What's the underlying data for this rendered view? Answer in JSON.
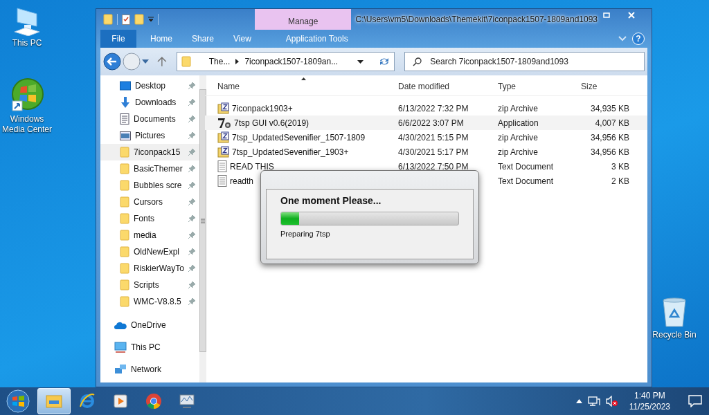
{
  "desktop": [
    {
      "label": "This PC",
      "kind": "pc"
    },
    {
      "label": "Windows Media Center",
      "kind": "wmc"
    },
    {
      "label": "Recycle Bin",
      "kind": "recycle"
    }
  ],
  "window": {
    "title": "C:\\Users\\vm5\\Downloads\\Themekit\\7iconpack1507-1809and1093",
    "context_tab": "Manage",
    "ribbon_tabs": [
      {
        "label": "File",
        "kind": "file"
      },
      {
        "label": "Home",
        "kind": "tab"
      },
      {
        "label": "Share",
        "kind": "tab"
      },
      {
        "label": "View",
        "kind": "tab"
      },
      {
        "label": "Application Tools",
        "kind": "tab"
      }
    ],
    "help": "?"
  },
  "address": {
    "breadcrumbs": [
      "The...",
      "7iconpack1507-1809an..."
    ]
  },
  "search": {
    "placeholder": "Search 7iconpack1507-1809and1093"
  },
  "nav": {
    "quick_access": [
      {
        "label": "Desktop",
        "kind": "desktop",
        "selected": false
      },
      {
        "label": "Downloads",
        "kind": "downloads",
        "selected": false
      },
      {
        "label": "Documents",
        "kind": "documents",
        "selected": false
      },
      {
        "label": "Pictures",
        "kind": "pictures",
        "selected": false
      },
      {
        "label": "7iconpack15",
        "kind": "folder",
        "selected": true
      },
      {
        "label": "BasicThemer",
        "kind": "folder",
        "selected": false
      },
      {
        "label": "Bubbles scre",
        "kind": "folder",
        "selected": false
      },
      {
        "label": "Cursors",
        "kind": "folder",
        "selected": false
      },
      {
        "label": "Fonts",
        "kind": "folder",
        "selected": false
      },
      {
        "label": "media",
        "kind": "folder",
        "selected": false
      },
      {
        "label": "OldNewExpl",
        "kind": "folder",
        "selected": false
      },
      {
        "label": "RiskierWayTo",
        "kind": "folder",
        "selected": false
      },
      {
        "label": "Scripts",
        "kind": "folder",
        "selected": false
      },
      {
        "label": "WMC-V8.8.5",
        "kind": "folder",
        "selected": false
      }
    ],
    "roots": [
      {
        "label": "OneDrive",
        "kind": "onedrive"
      },
      {
        "label": "This PC",
        "kind": "pc"
      },
      {
        "label": "Network",
        "kind": "network"
      }
    ]
  },
  "files": {
    "columns": [
      "Name",
      "Date modified",
      "Type",
      "Size"
    ],
    "rows": [
      {
        "name": "7iconpack1903+",
        "date": "6/13/2022 7:32 PM",
        "type": "zip Archive",
        "size": "34,935 KB",
        "kind": "zip",
        "selected": false
      },
      {
        "name": "7tsp GUI v0.6(2019)",
        "date": "6/6/2022 3:07 PM",
        "type": "Application",
        "size": "4,007 KB",
        "kind": "app",
        "selected": true
      },
      {
        "name": "7tsp_UpdatedSevenifier_1507-1809",
        "date": "4/30/2021 5:15 PM",
        "type": "zip Archive",
        "size": "34,956 KB",
        "kind": "zip",
        "selected": false
      },
      {
        "name": "7tsp_UpdatedSevenifier_1903+",
        "date": "4/30/2021 5:17 PM",
        "type": "zip Archive",
        "size": "34,956 KB",
        "kind": "zip",
        "selected": false
      },
      {
        "name": "READ THIS",
        "date": "6/13/2022 7:50 PM",
        "type": "Text Document",
        "size": "3 KB",
        "kind": "text",
        "selected": false
      },
      {
        "name": "readth",
        "type": "Text Document",
        "size": "2 KB",
        "kind": "text",
        "selected": false
      }
    ]
  },
  "dialog": {
    "heading": "One moment Please...",
    "level": 0.1,
    "status": "Preparing 7tsp"
  },
  "taskbar": {
    "apps": [
      {
        "kind": "explorer",
        "active": true
      },
      {
        "kind": "ie",
        "active": false
      },
      {
        "kind": "media",
        "active": false
      },
      {
        "kind": "chrome",
        "active": false
      },
      {
        "kind": "monitor",
        "active": false
      }
    ],
    "time": "1:40 PM",
    "date": "11/25/2023"
  }
}
